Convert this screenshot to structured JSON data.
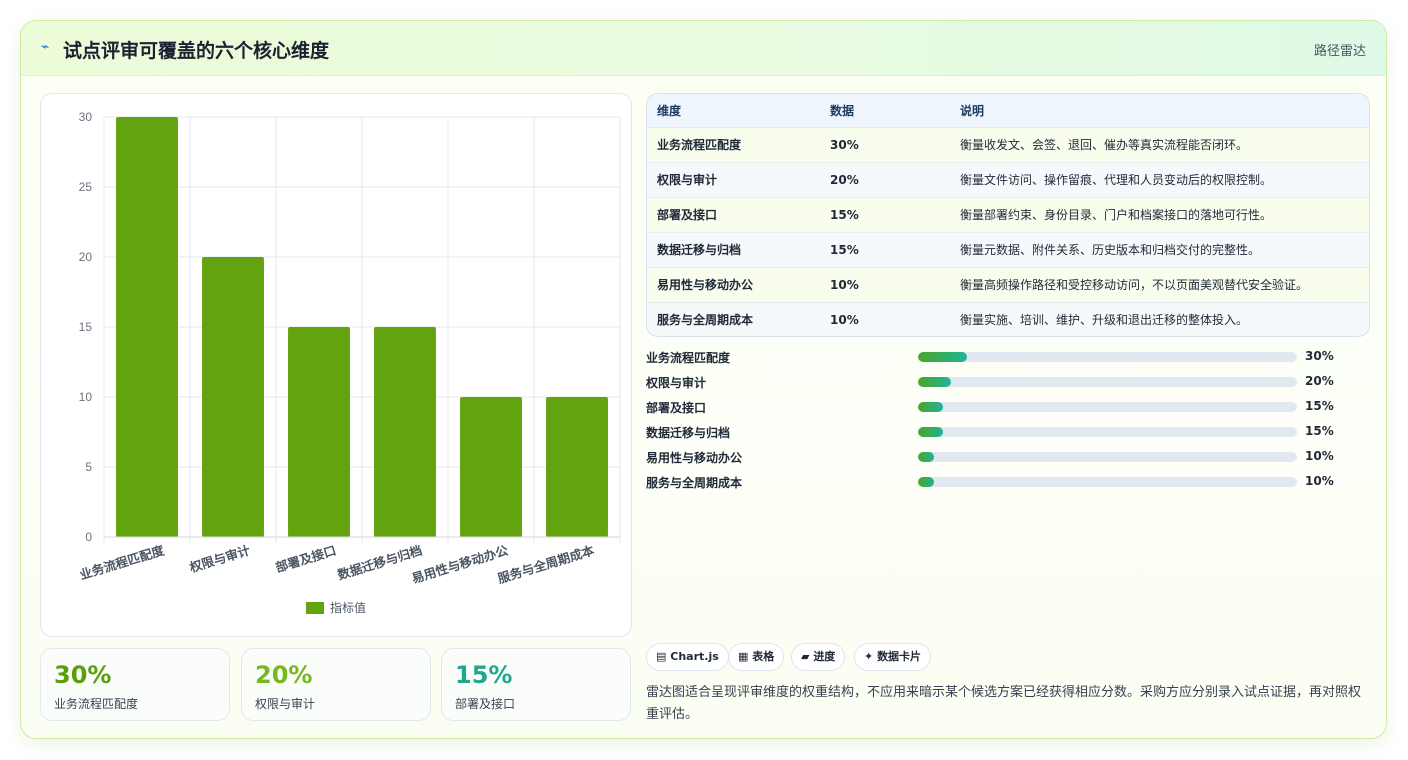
{
  "header": {
    "icon": "chart-line-icon",
    "title": "试点评审可覆盖的六个核心维度",
    "tag": "路径雷达"
  },
  "chart_data": {
    "type": "bar",
    "categories": [
      "业务流程匹配度",
      "权限与审计",
      "部署及接口",
      "数据迁移与归档",
      "易用性与移动办公",
      "服务与全周期成本"
    ],
    "series": [
      {
        "name": "指标值",
        "values": [
          30,
          20,
          15,
          15,
          10,
          10
        ],
        "color": "#62a30f"
      }
    ],
    "ylim": [
      0,
      30
    ],
    "yticks": [
      0,
      5,
      10,
      15,
      20,
      25,
      30
    ],
    "grid": true,
    "legend": "bottom"
  },
  "stats": [
    {
      "value": "30%",
      "label": "业务流程匹配度",
      "color": "#5a9e0d"
    },
    {
      "value": "20%",
      "label": "权限与审计",
      "color": "#76b81f"
    },
    {
      "value": "15%",
      "label": "部署及接口",
      "color": "#1fa88f"
    }
  ],
  "table": {
    "headers": [
      "维度",
      "数据",
      "说明"
    ],
    "rows": [
      {
        "dim": "业务流程匹配度",
        "val": "30%",
        "desc": "衡量收发文、会签、退回、催办等真实流程能否闭环。"
      },
      {
        "dim": "权限与审计",
        "val": "20%",
        "desc": "衡量文件访问、操作留痕、代理和人员变动后的权限控制。"
      },
      {
        "dim": "部署及接口",
        "val": "15%",
        "desc": "衡量部署约束、身份目录、门户和档案接口的落地可行性。"
      },
      {
        "dim": "数据迁移与归档",
        "val": "15%",
        "desc": "衡量元数据、附件关系、历史版本和归档交付的完整性。"
      },
      {
        "dim": "易用性与移动办公",
        "val": "10%",
        "desc": "衡量高频操作路径和受控移动访问，不以页面美观替代安全验证。"
      },
      {
        "dim": "服务与全周期成本",
        "val": "10%",
        "desc": "衡量实施、培训、维护、升级和退出迁移的整体投入。"
      }
    ]
  },
  "progress": [
    {
      "label": "业务流程匹配度",
      "value": "30%",
      "fraction": 0.13
    },
    {
      "label": "权限与审计",
      "value": "20%",
      "fraction": 0.087
    },
    {
      "label": "部署及接口",
      "value": "15%",
      "fraction": 0.065
    },
    {
      "label": "数据迁移与归档",
      "value": "15%",
      "fraction": 0.065
    },
    {
      "label": "易用性与移动办公",
      "value": "10%",
      "fraction": 0.043
    },
    {
      "label": "服务与全周期成本",
      "value": "10%",
      "fraction": 0.043
    }
  ],
  "chips": [
    {
      "icon": "chart-icon",
      "glyph": "▤",
      "label": "Chart.js"
    },
    {
      "icon": "table-icon",
      "glyph": "▦",
      "label": "表格"
    },
    {
      "icon": "progress-icon",
      "glyph": "▰",
      "label": "进度"
    },
    {
      "icon": "sparkle-icon",
      "glyph": "✦",
      "label": "数据卡片"
    }
  ],
  "note": "雷达图适合呈现评审维度的权重结构，不应用来暗示某个候选方案已经获得相应分数。采购方应分别录入试点证据，再对照权重评估。"
}
